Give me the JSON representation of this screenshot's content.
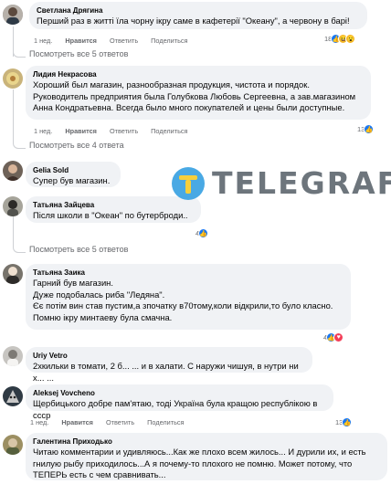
{
  "comments": [
    {
      "author": "Светлана Дрягина",
      "text": "Перший раз в житті їла чорну ікру саме в кафетерії \"Океану\", а червону в барі!",
      "time": "1 нед.",
      "like": "Нравится",
      "reply": "Ответить",
      "share": "Поделиться",
      "reaction_count": "18",
      "view_more": "Посмотреть все 5 ответов"
    },
    {
      "author": "Лидия Некрасова",
      "text": "Хороший был магазин, разнообразная продукция, чистота и порядок.\nРуководитель предприятия была Голубкова Любовь Сергеевна, а зав.магазином Анна Кондратьевна. Всегда было много покупателей и цены были доступные.",
      "time": "1 нед.",
      "like": "Нравится",
      "reply": "Ответить",
      "share": "Поделиться",
      "reaction_count": "13",
      "view_more": "Посмотреть все 4 ответа"
    },
    {
      "author": "Gelia Sold",
      "text": "Супер був магазин.",
      "time": "",
      "like": "",
      "reply": "",
      "share": "",
      "reaction_count": "",
      "view_more": ""
    },
    {
      "author": "Татьяна Зайцева",
      "text": "Після школи в \"Океан\" по бутерброди..",
      "time": "",
      "like": "",
      "reply": "",
      "share": "",
      "reaction_count": "4",
      "view_more": "Посмотреть все 5 ответов"
    },
    {
      "author": "Татьяна Заика",
      "text": "Гарний був магазин.\nДуже подобалась риба \"Ледяна\".\nЄє потім вин став пустим,а зпочатку в70тому,коли відкрили,то було класно.\nПомню ікру минтаеву була смачна.",
      "time": "",
      "like": "",
      "reply": "",
      "share": "",
      "reaction_count": "4",
      "view_more": ""
    },
    {
      "author": "Uriy Vetro",
      "text": "2хкильки в томати, 2 б... ... и в халати. С наружи чишуя, в нутри ни х... ...",
      "time": "",
      "like": "",
      "reply": "",
      "share": "",
      "reaction_count": "",
      "view_more": ""
    },
    {
      "author": "Aleksej Vovcheno",
      "text": "Щербицького добре пам'ятаю, тоді Україна була кращою республікою в ссср",
      "time": "1 нед.",
      "like": "Нравится",
      "reply": "Ответить",
      "share": "Поделиться",
      "reaction_count": "13",
      "view_more": ""
    },
    {
      "author": "Галентина Приходько",
      "text": "Читаю комментарии и удивляюсь...Как же плохо всем жилось... И дурили их, и есть гнилую рыбу приходилось...А я почему-то плохого не помню. Может потому, что ТЕПЕРЬ есть с чем сравнивать...",
      "time": "",
      "like": "",
      "reply": "",
      "share": "",
      "reaction_count": "",
      "view_more": ""
    }
  ],
  "watermark": {
    "brand": "TELEGRAF"
  }
}
